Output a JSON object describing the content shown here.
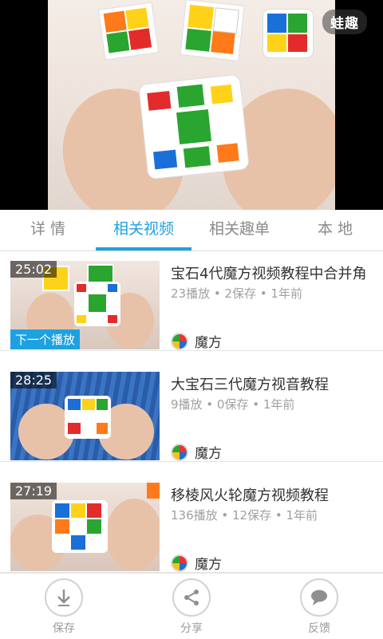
{
  "player": {
    "watermark": "蛙趣"
  },
  "tabs": [
    {
      "label": "详 情",
      "active": false
    },
    {
      "label": "相关视频",
      "active": true
    },
    {
      "label": "相关趣单",
      "active": false
    },
    {
      "label": "本 地",
      "active": false
    }
  ],
  "videos": [
    {
      "duration": "25:02",
      "badge": "下一个播放",
      "title": "宝石4代魔方视频教程中合并角",
      "meta": "23播放 • 2保存 • 1年前",
      "category": "魔方"
    },
    {
      "duration": "28:25",
      "title": "大宝石三代魔方视音教程",
      "meta": "9播放 • 0保存 • 1年前",
      "category": "魔方"
    },
    {
      "duration": "27:19",
      "title": "移棱风火轮魔方视频教程",
      "meta": "136播放 • 12保存 • 1年前",
      "category": "魔方"
    }
  ],
  "bottom": {
    "save": "保存",
    "share": "分享",
    "feedback": "反馈"
  },
  "colors": {
    "accent": "#1ea1e1",
    "text_gray": "#8a8a8a"
  }
}
